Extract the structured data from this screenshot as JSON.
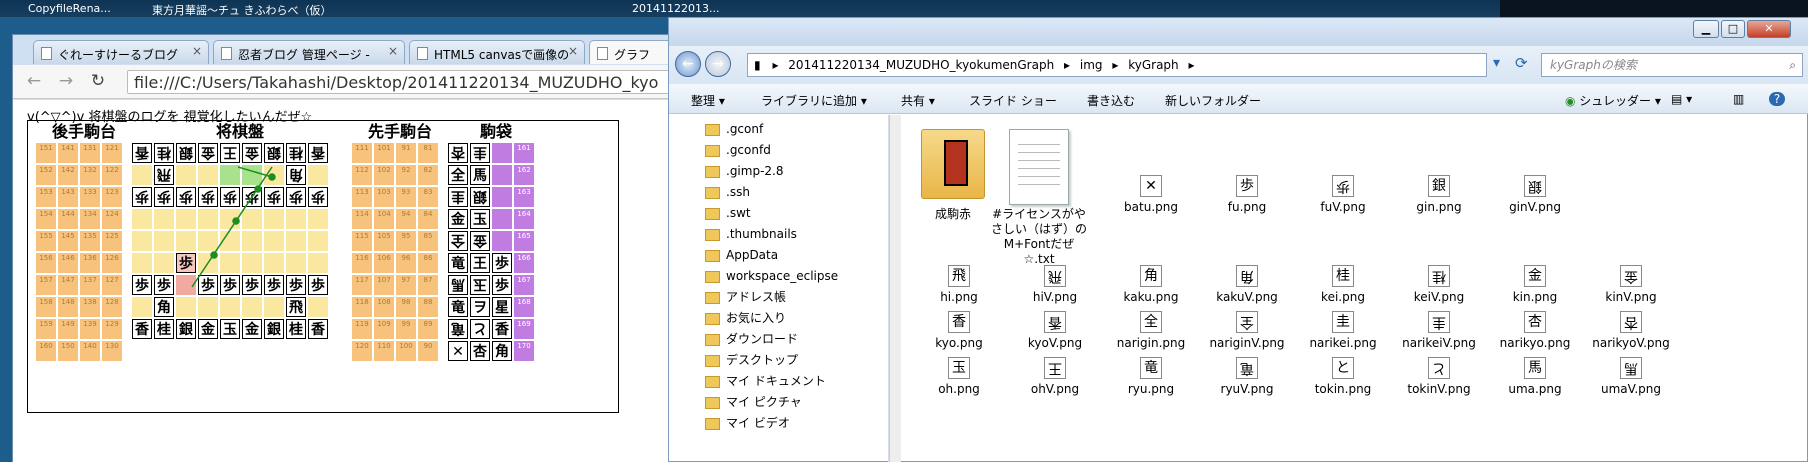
{
  "taskbar": {
    "items": [
      "CopyfileRena...",
      "東方月華謡～チュ きふわらべ（仮）",
      "20141122013..."
    ]
  },
  "browser": {
    "tabs": [
      {
        "label": "ぐれーすけーるブログ"
      },
      {
        "label": "忍者ブログ 管理ページ -"
      },
      {
        "label": "HTML5 canvasで画像の"
      },
      {
        "label": "グラフ"
      }
    ],
    "url": "file:///C:/Users/Takahashi/Desktop/201411220134_MUZUDHO_kyo"
  },
  "page": {
    "heading": "v(^▽^)v 将棋盤のログを 視覚化したいんだぜ☆",
    "labels": {
      "gote_dai": "後手駒台",
      "board": "将棋盤",
      "sente_dai": "先手駒台",
      "komabukuro": "駒袋"
    },
    "gote_dai_cells": [
      "151",
      "141",
      "131",
      "121",
      "152",
      "142",
      "132",
      "122",
      "153",
      "143",
      "133",
      "123",
      "154",
      "144",
      "134",
      "124",
      "155",
      "145",
      "135",
      "125",
      "156",
      "146",
      "136",
      "126",
      "157",
      "147",
      "137",
      "127",
      "158",
      "148",
      "138",
      "128",
      "159",
      "149",
      "139",
      "129",
      "160",
      "150",
      "140",
      "130"
    ],
    "sente_dai_cells": [
      "111",
      "101",
      "91",
      "81",
      "112",
      "102",
      "92",
      "82",
      "113",
      "103",
      "93",
      "83",
      "114",
      "104",
      "94",
      "84",
      "115",
      "105",
      "95",
      "85",
      "116",
      "106",
      "96",
      "86",
      "117",
      "107",
      "97",
      "87",
      "118",
      "108",
      "98",
      "88",
      "119",
      "109",
      "99",
      "89",
      "120",
      "110",
      "100",
      "90"
    ],
    "board_rows": [
      [
        "香",
        "桂",
        "銀",
        "金",
        "王",
        "金",
        "銀",
        "桂",
        "香"
      ],
      [
        "",
        "飛",
        "",
        "",
        "",
        "",
        "",
        "角",
        ""
      ],
      [
        "歩",
        "歩",
        "歩",
        "歩",
        "歩",
        "歩",
        "歩",
        "歩",
        "歩"
      ],
      [
        "",
        "",
        "",
        "",
        "",
        "",
        "",
        "",
        ""
      ],
      [
        "",
        "",
        "",
        "",
        "",
        "",
        "",
        "",
        ""
      ],
      [
        "",
        "",
        "歩",
        "",
        "",
        "",
        "",
        "",
        ""
      ],
      [
        "歩",
        "歩",
        "",
        "歩",
        "歩",
        "歩",
        "歩",
        "歩",
        "歩"
      ],
      [
        "",
        "角",
        "",
        "",
        "",
        "",
        "",
        "飛",
        ""
      ],
      [
        "香",
        "桂",
        "銀",
        "金",
        "玉",
        "金",
        "銀",
        "桂",
        "香"
      ]
    ],
    "komabukuro_rows": [
      [
        "杏",
        "圭"
      ],
      [
        "全",
        "馬"
      ],
      [
        "圭",
        "銀"
      ],
      [
        "金",
        "玉"
      ],
      [
        "全",
        "金"
      ],
      [
        "竜",
        "王"
      ],
      [
        "馬",
        "玉"
      ],
      [
        "竜",
        "ヲ"
      ],
      [
        "竜",
        "と"
      ],
      [
        "✕",
        "杏"
      ]
    ],
    "komabukuro_right": [
      [
        "",
        "161"
      ],
      [
        "",
        "162"
      ],
      [
        "",
        "163"
      ],
      [
        "",
        "164"
      ],
      [
        "",
        "165"
      ],
      [
        "歩",
        "166"
      ],
      [
        "歩",
        "167"
      ],
      [
        "星",
        "168"
      ],
      [
        "香",
        "169"
      ],
      [
        "角",
        "170"
      ]
    ]
  },
  "explorer": {
    "breadcrumb": [
      "201411220134_MUZUDHO_kyokumenGraph",
      "img",
      "kyGraph"
    ],
    "search_placeholder": "kyGraphの検索",
    "commands": [
      "整理 ▾",
      "ライブラリに追加 ▾",
      "共有 ▾",
      "スライド ショー",
      "書き込む",
      "新しいフォルダー"
    ],
    "shredder": "シュレッダー",
    "nav": [
      ".gconf",
      ".gconfd",
      ".gimp-2.8",
      ".ssh",
      ".swt",
      ".thumbnails",
      "AppData",
      "workspace_eclipse",
      "アドレス帳",
      "お気に入り",
      "ダウンロード",
      "デスクトップ",
      "マイ ドキュメント",
      "マイ ピクチャ",
      "マイ ビデオ"
    ],
    "folder_big": "成駒赤",
    "txt_big": "#ライセンスがやさしい（はず）のM+Fontだぜ☆.txt",
    "files": [
      {
        "name": "batu.png",
        "glyph": "✕"
      },
      {
        "name": "fu.png",
        "glyph": "歩"
      },
      {
        "name": "fuV.png",
        "glyph": "歩"
      },
      {
        "name": "gin.png",
        "glyph": "銀"
      },
      {
        "name": "ginV.png",
        "glyph": "銀"
      },
      {
        "name": "hi.png",
        "glyph": "飛"
      },
      {
        "name": "hiV.png",
        "glyph": "飛"
      },
      {
        "name": "kaku.png",
        "glyph": "角"
      },
      {
        "name": "kakuV.png",
        "glyph": "角"
      },
      {
        "name": "kei.png",
        "glyph": "桂"
      },
      {
        "name": "keiV.png",
        "glyph": "桂"
      },
      {
        "name": "kin.png",
        "glyph": "金"
      },
      {
        "name": "kinV.png",
        "glyph": "金"
      },
      {
        "name": "kyo.png",
        "glyph": "香"
      },
      {
        "name": "kyoV.png",
        "glyph": "香"
      },
      {
        "name": "narigin.png",
        "glyph": "全"
      },
      {
        "name": "nariginV.png",
        "glyph": "全"
      },
      {
        "name": "narikei.png",
        "glyph": "圭"
      },
      {
        "name": "narikeiV.png",
        "glyph": "圭"
      },
      {
        "name": "narikyo.png",
        "glyph": "杏"
      },
      {
        "name": "narikyoV.png",
        "glyph": "杏"
      },
      {
        "name": "oh.png",
        "glyph": "玉"
      },
      {
        "name": "ohV.png",
        "glyph": "王"
      },
      {
        "name": "ryu.png",
        "glyph": "竜"
      },
      {
        "name": "ryuV.png",
        "glyph": "竜"
      },
      {
        "name": "tokin.png",
        "glyph": "と"
      },
      {
        "name": "tokinV.png",
        "glyph": "と"
      },
      {
        "name": "uma.png",
        "glyph": "馬"
      },
      {
        "name": "umaV.png",
        "glyph": "馬"
      }
    ]
  }
}
